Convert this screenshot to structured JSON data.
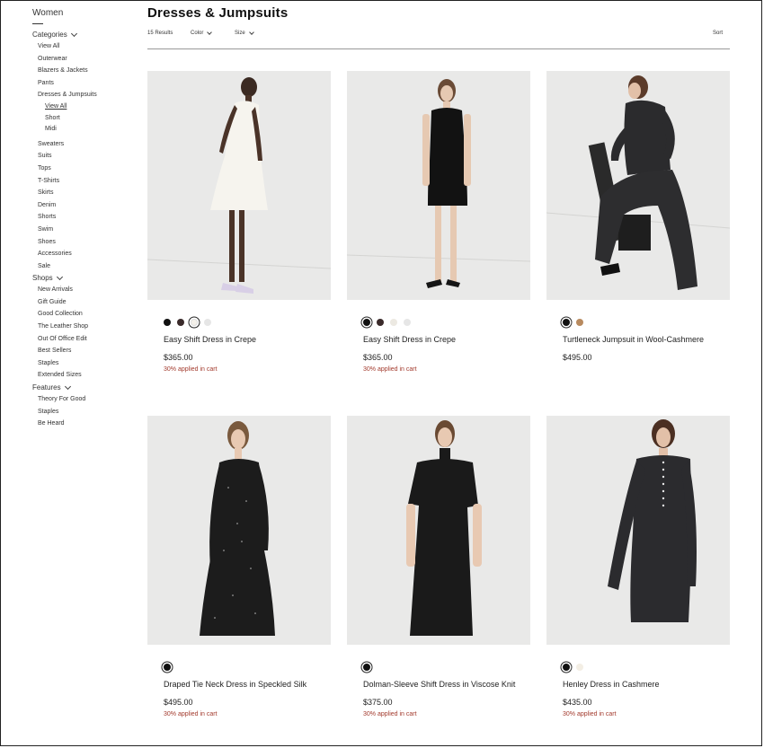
{
  "sidebar": {
    "title": "Women",
    "sections": [
      {
        "label": "Categories",
        "items": [
          {
            "label": "View All"
          },
          {
            "label": "Outerwear"
          },
          {
            "label": "Blazers & Jackets"
          },
          {
            "label": "Pants"
          },
          {
            "label": "Dresses & Jumpsuits",
            "sub": [
              {
                "label": "View All",
                "active": true
              },
              {
                "label": "Short"
              },
              {
                "label": "Midi"
              }
            ]
          },
          {
            "label": "Sweaters"
          },
          {
            "label": "Suits"
          },
          {
            "label": "Tops"
          },
          {
            "label": "T-Shirts"
          },
          {
            "label": "Skirts"
          },
          {
            "label": "Denim"
          },
          {
            "label": "Shorts"
          },
          {
            "label": "Swim"
          },
          {
            "label": "Shoes"
          },
          {
            "label": "Accessories"
          },
          {
            "label": "Sale"
          }
        ]
      },
      {
        "label": "Shops",
        "items": [
          {
            "label": "New Arrivals"
          },
          {
            "label": "Gift Guide"
          },
          {
            "label": "Good Collection"
          },
          {
            "label": "The Leather Shop"
          },
          {
            "label": "Out Of Office Edit"
          },
          {
            "label": "Best Sellers"
          },
          {
            "label": "Staples"
          },
          {
            "label": "Extended Sizes"
          }
        ]
      },
      {
        "label": "Features",
        "items": [
          {
            "label": "Theory For Good"
          },
          {
            "label": "Staples"
          },
          {
            "label": "Be Heard"
          }
        ]
      }
    ]
  },
  "header": {
    "title": "Dresses & Jumpsuits",
    "results": "15 Results",
    "color_filter": "Color",
    "size_filter": "Size",
    "sort": "Sort"
  },
  "colors": {
    "promo": "#a33b2e",
    "image_bg": "#e9e9e8"
  },
  "products": [
    {
      "name": "Easy Shift Dress in Crepe",
      "price": "$365.00",
      "promo": "30% applied in cart",
      "swatches": [
        {
          "color": "#111111"
        },
        {
          "color": "#3a2a2a"
        },
        {
          "color": "#f4f1ea",
          "selected": true
        },
        {
          "color": "#e6e6e6"
        }
      ],
      "image": "model-white-dress"
    },
    {
      "name": "Easy Shift Dress in Crepe",
      "price": "$365.00",
      "promo": "30% applied in cart",
      "swatches": [
        {
          "color": "#111111",
          "selected": true
        },
        {
          "color": "#3a2a2a"
        },
        {
          "color": "#ece9e2"
        },
        {
          "color": "#e6e6e6"
        }
      ],
      "image": "model-black-dress"
    },
    {
      "name": "Turtleneck Jumpsuit in Wool-Cashmere",
      "price": "$495.00",
      "promo": "",
      "swatches": [
        {
          "color": "#111111",
          "selected": true
        },
        {
          "color": "#b88a5f"
        }
      ],
      "image": "model-jumpsuit"
    },
    {
      "name": "Draped Tie Neck Dress in Speckled Silk",
      "price": "$495.00",
      "promo": "30% applied in cart",
      "swatches": [
        {
          "color": "#111111",
          "selected": true
        }
      ],
      "image": "model-speckled-dress"
    },
    {
      "name": "Dolman-Sleeve Shift Dress in Viscose Knit",
      "price": "$375.00",
      "promo": "30% applied in cart",
      "swatches": [
        {
          "color": "#111111",
          "selected": true
        }
      ],
      "image": "model-knit-dress"
    },
    {
      "name": "Henley Dress in Cashmere",
      "price": "$435.00",
      "promo": "30% applied in cart",
      "swatches": [
        {
          "color": "#111111",
          "selected": true
        },
        {
          "color": "#f3eee4"
        }
      ],
      "image": "model-henley-dress"
    }
  ]
}
